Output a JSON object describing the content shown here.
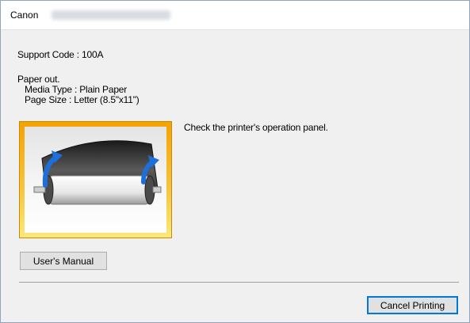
{
  "window": {
    "title": "Canon"
  },
  "support": {
    "code_line": "Support Code : 100A"
  },
  "message": {
    "line1": "Paper out.",
    "line2": "Media Type : Plain Paper",
    "line3": "Page Size : Letter (8.5\"x11\")",
    "instruction": "Check the printer's operation panel."
  },
  "buttons": {
    "users_manual": "User's Manual",
    "cancel_printing": "Cancel Printing"
  },
  "colors": {
    "illustration_frame": "#f4a300",
    "arrow": "#1e6fd9",
    "default_button_border": "#0078d7"
  }
}
